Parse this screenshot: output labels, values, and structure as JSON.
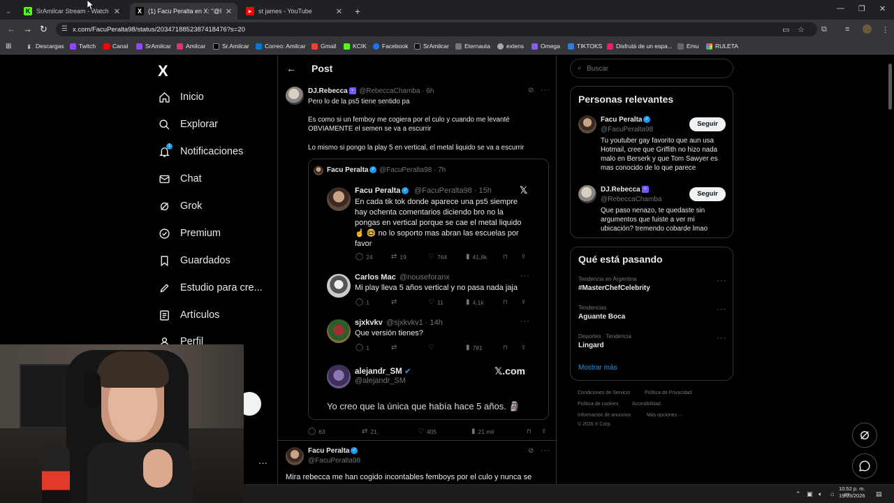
{
  "browser": {
    "tabs": [
      {
        "title": "SrAmilcar Stream - Watch Live",
        "fav": "K"
      },
      {
        "title": "(1) Facu Peralta en X: \"@Rebecc",
        "fav": "X"
      },
      {
        "title": "st james - YouTube",
        "fav": "▶"
      }
    ],
    "new_tab": "+",
    "url": "x.com/FacuPeralta98/status/2034718852387418476?s=20",
    "bookmarks": [
      "Descargas",
      "Twitch",
      "Canal",
      "SrAmilcar",
      "Amilcar",
      "Sr.Amilcar",
      "Correo: Amilcar",
      "Gmail",
      "KCIK",
      "Facebook",
      "SrAmilcar",
      "Eternauta",
      "extens",
      "Omega",
      "TIKTOKS",
      "Disfrutá de un espa...",
      "Emu",
      "RULETA"
    ]
  },
  "nav": {
    "logo": "X",
    "items": [
      {
        "label": "Inicio",
        "icon": "home-icon"
      },
      {
        "label": "Explorar",
        "icon": "search-icon"
      },
      {
        "label": "Notificaciones",
        "icon": "bell-icon",
        "badge": "1"
      },
      {
        "label": "Chat",
        "icon": "mail-icon"
      },
      {
        "label": "Grok",
        "icon": "grok-icon"
      },
      {
        "label": "Premium",
        "icon": "verified-icon"
      },
      {
        "label": "Guardados",
        "icon": "bookmark-icon"
      },
      {
        "label": "Estudio para cre...",
        "icon": "rocket-icon"
      },
      {
        "label": "Artículos",
        "icon": "article-icon"
      },
      {
        "label": "Perfil",
        "icon": "person-icon"
      }
    ]
  },
  "post_header": {
    "title": "Post"
  },
  "main_post": {
    "name": "DJ.Rebecca",
    "handle": "@RebeccaChamba",
    "time": "· 6h",
    "lines": [
      "Pero lo de la ps5 tiene sentido pa",
      "Es como si un femboy me cogiera por el culo y cuando me levanté",
      "OBVIAMENTE el semen se va a escurrir",
      "Lo mismo si pongo la play 5 en vertical, el metal liquido se va a escurrir"
    ],
    "quote": {
      "name": "Facu Peralta",
      "handle": "@FacuPeralta98",
      "time": "· 7h",
      "inner": {
        "name": "Facu Peralta",
        "handle": "@FacuPeralta98",
        "time": "· 15h",
        "lines": [
          "En cada tik tok donde aparece una ps5 siempre",
          "hay ochenta comentarios diciendo bro no la",
          "pongas en vertical porque se cae el metal liquido",
          "☝️ 🤓 no lo soporto mas abran las escuelas por",
          "favor"
        ],
        "stats": {
          "replies": "24",
          "reposts": "19",
          "likes": "764",
          "views": "41,8k"
        }
      },
      "reply1": {
        "name": "Carlos Mac",
        "handle": "@nouseforanx",
        "text": "Mi play lleva 5 años vertical y no pasa nada jaja",
        "stats": {
          "replies": "1",
          "reposts": "",
          "likes": "11",
          "views": "4,1k"
        }
      },
      "reply2": {
        "name": "sjxkvkv",
        "handle": "@sjxkvkv1",
        "time": "· 14h",
        "text": "Que versión tienes?",
        "stats": {
          "replies": "1",
          "reposts": "",
          "likes": "",
          "views": "781"
        }
      },
      "card": {
        "name": "alejandr_SM",
        "handle": "@alejandr_SM",
        "brand": "𝕏.com",
        "text": "Yo creo que la única que había hace 5 años. 🗿"
      }
    },
    "stats": {
      "replies": "63",
      "reposts": "21",
      "likes": "405",
      "views": "21 mil"
    }
  },
  "second_post": {
    "name": "Facu Peralta",
    "handle": "@FacuPeralta98",
    "text": "Mira rebecca me han cogido incontables femboys por el culo y nunca se"
  },
  "right": {
    "search_placeholder": "Buscar",
    "relevant": {
      "title": "Personas relevantes",
      "people": [
        {
          "name": "Facu Peralta",
          "handle": "@FacuPeralta98",
          "button": "Seguir",
          "bio": [
            "Tu youtuber gay favorito que aun usa",
            "Hotmail, cree que Griffith no hizo nada",
            "malo en Berserk y que Tom Sawyer es",
            "mas conocido de lo que parece"
          ]
        },
        {
          "name": "DJ.Rebecca",
          "handle": "@RebeccaChamba",
          "button": "Seguir",
          "bio": [
            "Que paso nenazo, te quedaste sin",
            "argumentos que fuiste a ver mi",
            "ubicación? tremendo cobarde lmao"
          ]
        }
      ]
    },
    "trending": {
      "title": "Qué está pasando",
      "items": [
        {
          "sub": "Tendencia en Argentina",
          "name": "#MasterChefCelebrity"
        },
        {
          "sub": "Tendencias",
          "name": "Aguante Boca"
        },
        {
          "sub": "Deportes · Tendencia",
          "name": "Lingard"
        }
      ],
      "more": "Mostrar más"
    },
    "footer": [
      "Condiciones de Servicio",
      "Política de Privacidad",
      "Política de cookies",
      "Accesibilidad",
      "Información de anuncios",
      "Más opciones ···",
      "© 2026 X Corp."
    ]
  },
  "taskbar": {
    "time": "10:52 p. m.",
    "date": "19/03/2026"
  }
}
